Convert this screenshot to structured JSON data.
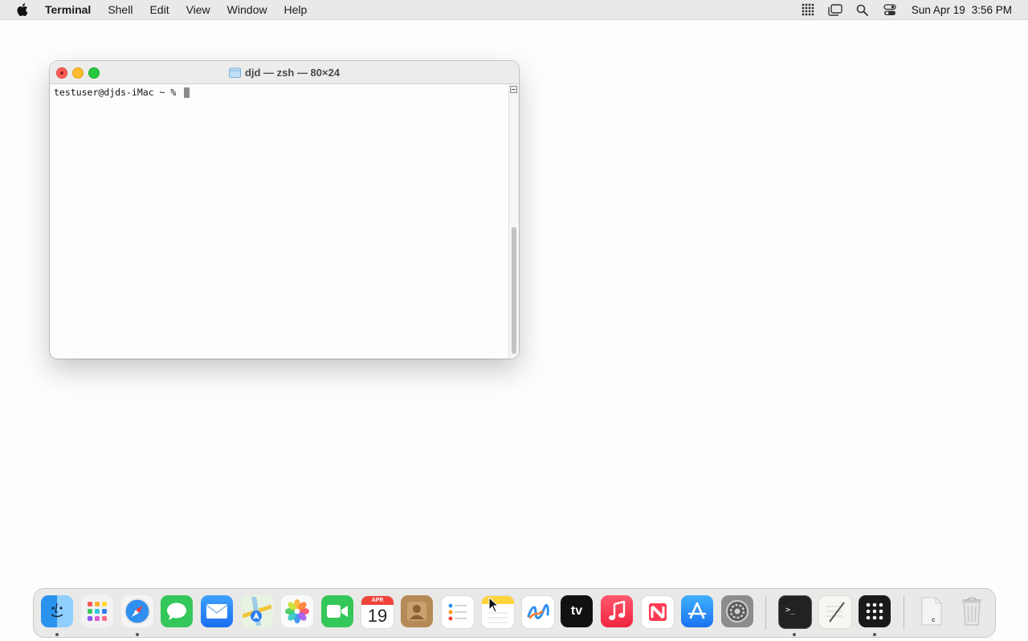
{
  "menubar": {
    "app_name": "Terminal",
    "items": [
      "Shell",
      "Edit",
      "View",
      "Window",
      "Help"
    ],
    "date": "Sun Apr 19",
    "time": "3:56 PM",
    "status_icons": [
      "grid-icon",
      "stage-manager-icon",
      "search-icon",
      "control-center-icon"
    ]
  },
  "terminal": {
    "title": "djd — zsh — 80×24",
    "prompt": "testuser@djds-iMac ~ % "
  },
  "dock": {
    "calendar_month": "APR",
    "calendar_day": "19",
    "apps": [
      "Finder",
      "Launchpad",
      "Safari",
      "Messages",
      "Mail",
      "Maps",
      "Photos",
      "FaceTime",
      "Calendar",
      "Contacts",
      "Reminders",
      "Notes",
      "Freeform",
      "TV",
      "Music",
      "News",
      "App Store",
      "System Settings",
      "Terminal",
      "TextEdit",
      "Launcher",
      "Downloads",
      "Trash"
    ],
    "apple_tv_label": "tv",
    "doc_label": "c"
  },
  "colors": {
    "accent_blue": "#1e8cf0",
    "close": "#ff5f57",
    "minimize": "#febc2e",
    "maximize": "#28c840"
  }
}
